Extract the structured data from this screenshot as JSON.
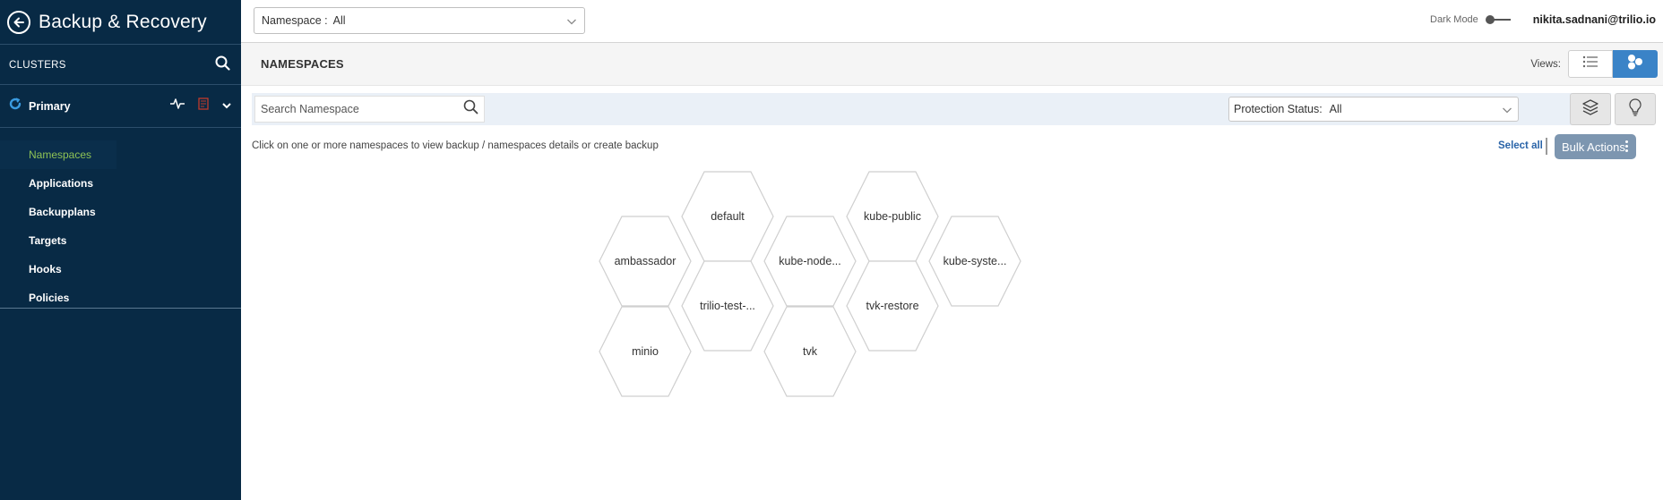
{
  "sidebar": {
    "title": "Backup & Recovery",
    "clusters_label": "CLUSTERS",
    "cluster_name": "Primary",
    "nav": [
      {
        "label": "Namespaces",
        "active": true
      },
      {
        "label": "Applications"
      },
      {
        "label": "Backupplans"
      },
      {
        "label": "Targets"
      },
      {
        "label": "Hooks"
      },
      {
        "label": "Policies"
      }
    ]
  },
  "topbar": {
    "namespace_label": "Namespace :",
    "namespace_value": "All",
    "dark_mode_label": "Dark Mode",
    "user": "nikita.sadnani@trilio.io"
  },
  "header": {
    "title": "NAMESPACES",
    "views_label": "Views:"
  },
  "filters": {
    "search_placeholder": "Search Namespace",
    "protection_label": "Protection Status:",
    "protection_value": "All"
  },
  "hint": "Click on one or more namespaces to view backup / namespaces details or create backup",
  "select_all": "Select all",
  "bulk_actions": "Bulk Actions",
  "namespaces": [
    "default",
    "kube-public",
    "ambassador",
    "kube-node...",
    "kube-syste...",
    "trilio-test-...",
    "tvk-restore",
    "minio",
    "tvk"
  ],
  "colors": {
    "sidebar_bg": "#082a45",
    "active_nav": "#8ec255",
    "accent": "#3a83c7",
    "bulk_bg": "#7d96b0",
    "filter_bg": "#eaf0f7"
  },
  "icons": {
    "back": "arrow-left-circle-icon",
    "search": "search-icon",
    "cluster": "sync-icon",
    "health": "activity-icon",
    "report": "document-icon",
    "expand": "chevron-down-icon",
    "list_view": "list-icon",
    "graph_view": "hexagon-cluster-icon",
    "layers": "layers-icon",
    "hint": "lightbulb-icon"
  }
}
